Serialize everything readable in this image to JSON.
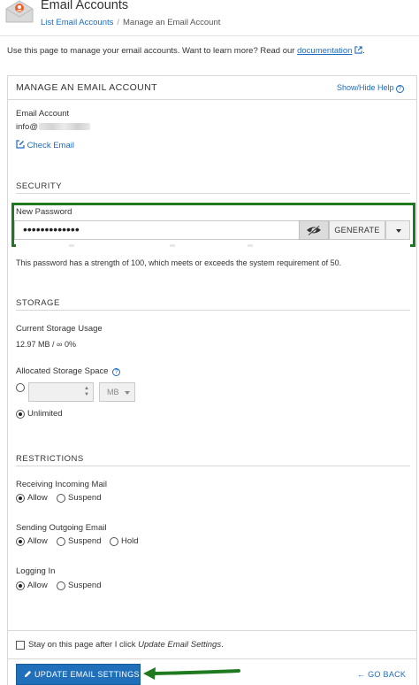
{
  "header": {
    "title": "Email Accounts",
    "breadcrumb": {
      "parent": "List Email Accounts",
      "separator": "/",
      "current": "Manage an Email Account"
    }
  },
  "intro": {
    "text": "Use this page to manage your email accounts. Want to learn more? Read our",
    "link": "documentation",
    "suffix": "."
  },
  "panel": {
    "title": "MANAGE AN EMAIL ACCOUNT",
    "help_label": "Show/Hide Help",
    "help_icon": "?"
  },
  "account": {
    "label": "Email Account",
    "value_prefix": "info@",
    "check_email": "Check Email"
  },
  "security": {
    "section_title": "SECURITY",
    "password_label": "New Password",
    "password_value": "•••••••••••••",
    "generate_label": "GENERATE",
    "strength_text": "This password has a strength of 100, which meets or exceeds the system requirement of 50.",
    "strength_percent": 100
  },
  "storage": {
    "section_title": "STORAGE",
    "usage_label": "Current Storage Usage",
    "usage_value": "12.97 MB / ∞ 0%",
    "allocated_label": "Allocated Storage Space",
    "help_icon": "?",
    "quota_value": "",
    "unit": "MB",
    "unlimited_label": "Unlimited",
    "selected": "unlimited"
  },
  "restrictions": {
    "section_title": "RESTRICTIONS",
    "incoming": {
      "label": "Receiving Incoming Mail",
      "options": [
        "Allow",
        "Suspend"
      ],
      "selected": "Allow"
    },
    "outgoing": {
      "label": "Sending Outgoing Email",
      "options": [
        "Allow",
        "Suspend",
        "Hold"
      ],
      "selected": "Allow"
    },
    "login": {
      "label": "Logging In",
      "options": [
        "Allow",
        "Suspend"
      ],
      "selected": "Allow"
    }
  },
  "footer": {
    "stay_prefix": "Stay on this page after I click ",
    "stay_emph": "Update Email Settings",
    "stay_suffix": ".",
    "stay_checked": false,
    "update_button": "UPDATE EMAIL SETTINGS",
    "go_back": "GO BACK"
  },
  "colors": {
    "highlight": "#1f7a1f",
    "primary": "#1f6fba",
    "link": "#1e6bbf",
    "logo": "#e8642c"
  },
  "icons": [
    "envelope-user-logo-icon",
    "external-link-icon",
    "edit-icon",
    "eye-slash-icon",
    "caret-down-icon",
    "question-circle-icon",
    "pencil-icon",
    "arrow-left-icon",
    "annotation-arrow-icon"
  ]
}
